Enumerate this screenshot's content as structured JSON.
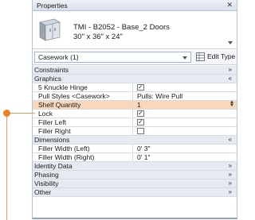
{
  "palette": {
    "name": "Properties",
    "close_icon": "✕"
  },
  "type_selector": {
    "name": "TMI - B2052 - Base_2 Doors",
    "dimensions": "30\" x 36\" x 24\""
  },
  "category_filter": {
    "value": "Casework (1)"
  },
  "edit_type": {
    "label": "Edit Type"
  },
  "groups": {
    "constraints": "Constraints",
    "graphics": "Graphics",
    "dimensions": "Dimensions",
    "identity_data": "Identity Data",
    "phasing": "Phasing",
    "visibility": "Visibility",
    "other": "Other"
  },
  "graphics_props": [
    {
      "label": "5 Knuckle Hinge",
      "checked": true
    },
    {
      "label": "Pull Styles <Casework>",
      "value": "Pulls: Wire Pull"
    },
    {
      "label": "Shelf Quantity",
      "value": "1"
    },
    {
      "label": "Lock",
      "checked": true
    },
    {
      "label": "Filler Left",
      "checked": true
    },
    {
      "label": "Filler Right",
      "checked": false
    }
  ],
  "dimension_props": [
    {
      "label": "Filler Width (Left)",
      "value": "0'  3\""
    },
    {
      "label": "Filler Width (Right)",
      "value": "0'  1\""
    }
  ],
  "colors": {
    "highlight": "#f9d7b8",
    "callout": "#f07f1e"
  }
}
